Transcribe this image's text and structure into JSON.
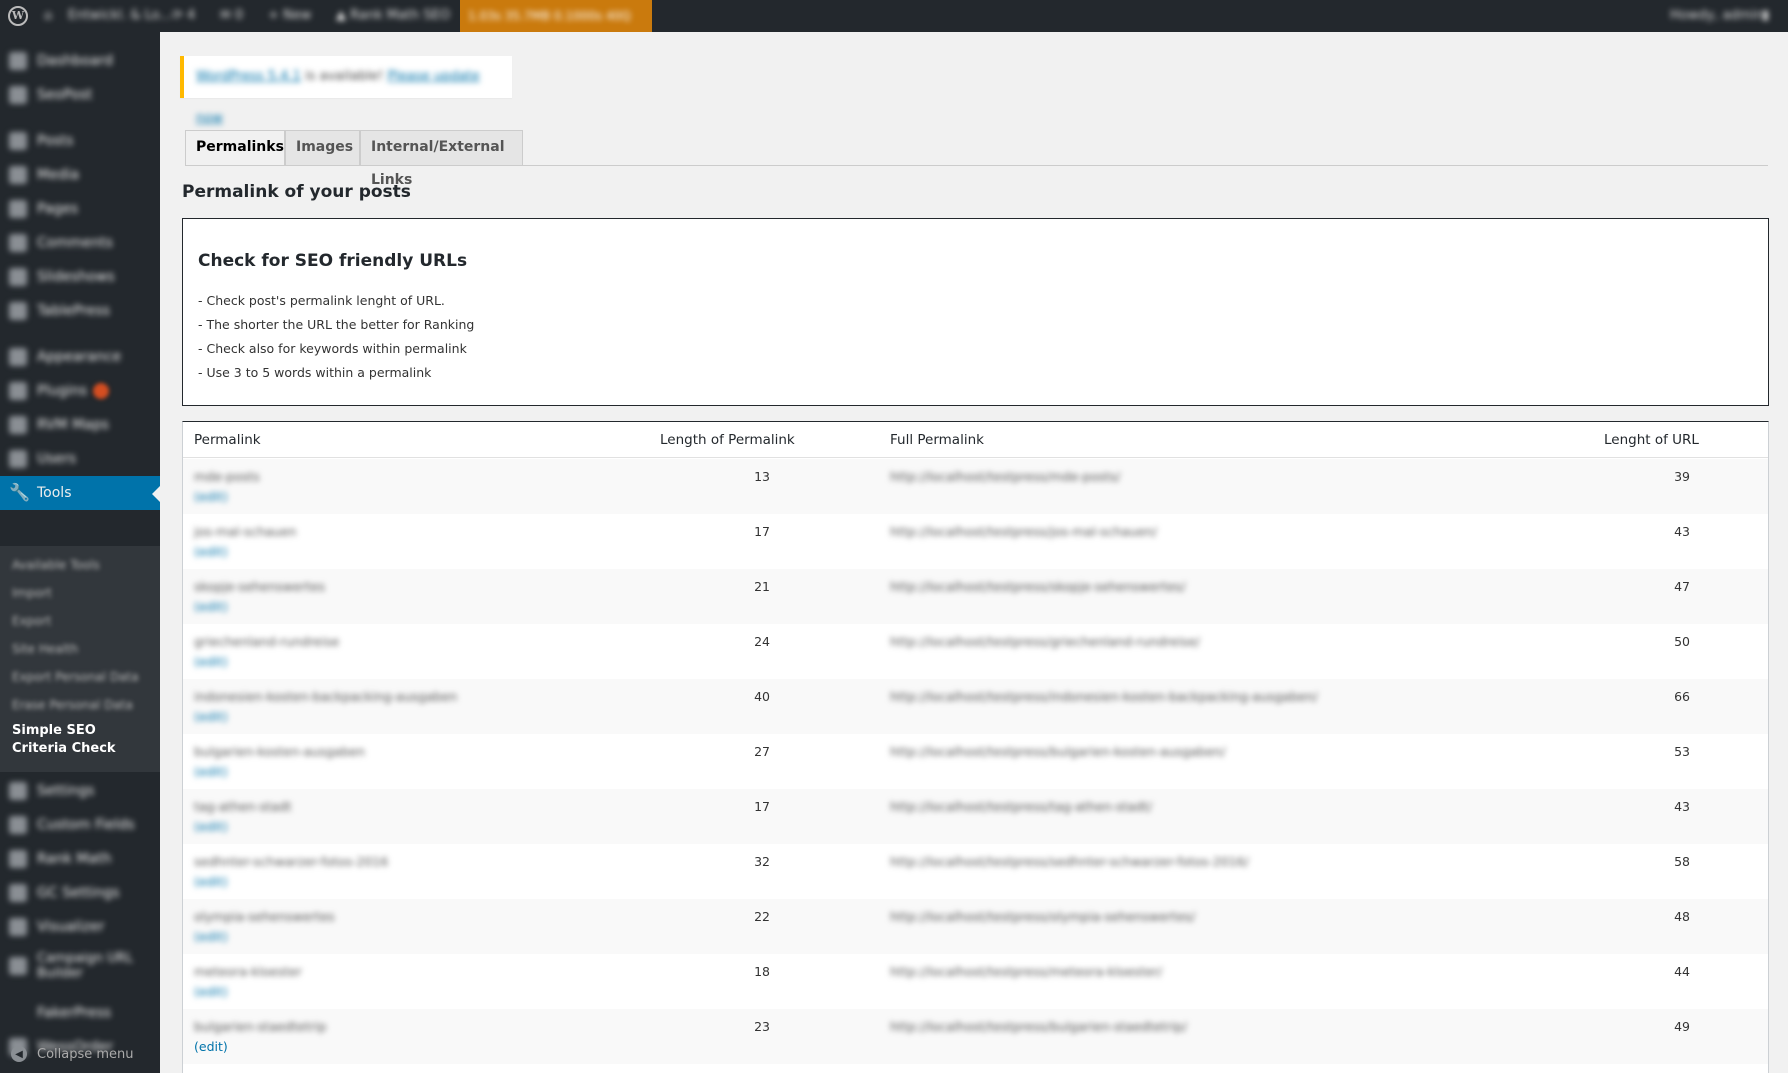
{
  "adminbar": {
    "wp_logo": "W",
    "site": "Entwickl. & Lo...",
    "updates": "4",
    "comments": "0",
    "new": "New",
    "rankmath": "Rank Math SEO",
    "perf": "1.03s  35.7MB  0.1000s  40Q",
    "howdy": "Howdy, admin"
  },
  "sidebar": {
    "items": [
      "Dashboard",
      "SeoPost",
      "Posts",
      "Media",
      "Pages",
      "Comments",
      "Slideshows",
      "TablePress",
      "Appearance",
      "Plugins",
      "RVM Maps",
      "Users"
    ],
    "tools": "Tools",
    "submenu": [
      "Available Tools",
      "Import",
      "Export",
      "Site Health",
      "Export Personal Data",
      "Erase Personal Data"
    ],
    "submenu_active": "Simple SEO Criteria Check",
    "items_after": [
      "Settings",
      "Custom Fields",
      "Rank Math",
      "GC Settings",
      "Visualizer",
      "Campaign URL Builder",
      "FakerPress",
      "WessOrder"
    ],
    "collapse": "Collapse menu"
  },
  "notice": {
    "link1": "WordPress 5.4.1",
    "middle": "is available!",
    "link2": "Please update now"
  },
  "tabs": [
    "Permalinks",
    "Images",
    "Internal/External Links"
  ],
  "page_title": "Permalink of your posts",
  "infobox": {
    "title": "Check for SEO friendly URLs",
    "lines": [
      "- Check post's permalink lenght of URL.",
      "- The shorter the URL the better for Ranking",
      "- Check also for keywords within permalink",
      "- Use 3 to 5 words within a permalink"
    ]
  },
  "table": {
    "headers": [
      "Permalink",
      "Length of Permalink",
      "Full Permalink",
      "Lenght of URL"
    ],
    "edit_label": "(edit)",
    "rows": [
      {
        "slug": "mde-posts",
        "len": "13",
        "full": "http://localhost/testpress/mde-posts/",
        "url_len": "39"
      },
      {
        "slug": "jos-mal-schauen",
        "len": "17",
        "full": "http://localhost/testpress/jos-mal-schauen/",
        "url_len": "43"
      },
      {
        "slug": "skopje-sehenswertes",
        "len": "21",
        "full": "http://localhost/testpress/skopje-sehenswertes/",
        "url_len": "47"
      },
      {
        "slug": "griechenland-rundreise",
        "len": "24",
        "full": "http://localhost/testpress/griechenland-rundreise/",
        "url_len": "50"
      },
      {
        "slug": "indonesien-kosten-backpacking-ausgaben",
        "len": "40",
        "full": "http://localhost/testpress/indonesien-kosten-backpacking-ausgaben/",
        "url_len": "66"
      },
      {
        "slug": "bulgarien-kosten-ausgaben",
        "len": "27",
        "full": "http://localhost/testpress/bulgarien-kosten-ausgaben/",
        "url_len": "53"
      },
      {
        "slug": "tag-athen-stadt",
        "len": "17",
        "full": "http://localhost/testpress/tag-athen-stadt/",
        "url_len": "43"
      },
      {
        "slug": "sedhnter-schwarzer-fotos-2016",
        "len": "32",
        "full": "http://localhost/testpress/sedhnter-schwarzer-fotos-2016/",
        "url_len": "58"
      },
      {
        "slug": "olympia-sehenswertes",
        "len": "22",
        "full": "http://localhost/testpress/olympia-sehenswertes/",
        "url_len": "48"
      },
      {
        "slug": "meteora-kloester",
        "len": "18",
        "full": "http://localhost/testpress/meteora-kloester/",
        "url_len": "44"
      },
      {
        "slug": "bulgarien-staedtetrip",
        "len": "23",
        "full": "http://localhost/testpress/bulgarien-staedtetrip/",
        "url_len": "49"
      }
    ]
  }
}
